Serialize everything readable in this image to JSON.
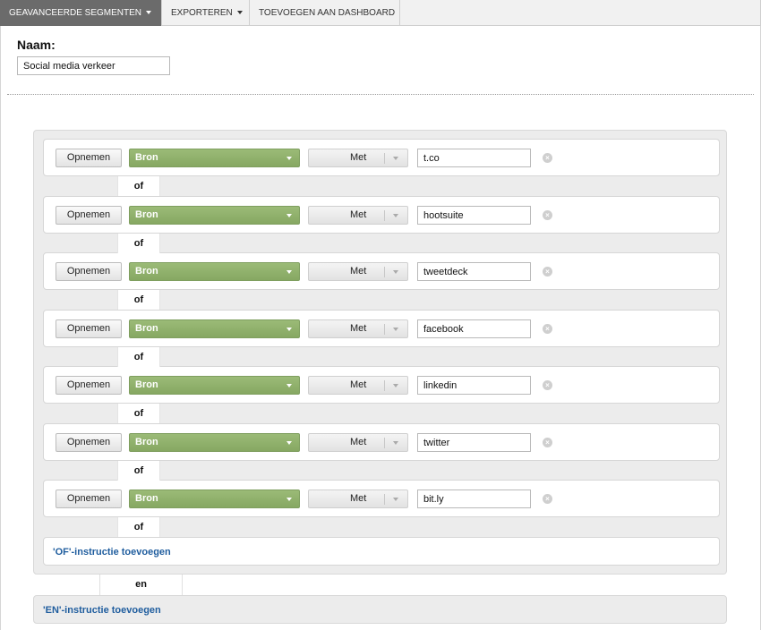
{
  "toolbar": {
    "tabs": [
      {
        "label": "GEAVANCEERDE SEGMENTEN",
        "has_dropdown": true,
        "active": true
      },
      {
        "label": "EXPORTEREN",
        "has_dropdown": true,
        "active": false
      },
      {
        "label": "TOEVOEGEN AAN DASHBOARD",
        "has_dropdown": false,
        "active": false
      }
    ]
  },
  "segment": {
    "name_label": "Naam:",
    "name_value": "Social media verkeer"
  },
  "conditions": [
    {
      "include_label": "Opnemen",
      "dimension": "Bron",
      "operator": "Met",
      "value": "t.co"
    },
    {
      "include_label": "Opnemen",
      "dimension": "Bron",
      "operator": "Met",
      "value": "hootsuite"
    },
    {
      "include_label": "Opnemen",
      "dimension": "Bron",
      "operator": "Met",
      "value": "tweetdeck"
    },
    {
      "include_label": "Opnemen",
      "dimension": "Bron",
      "operator": "Met",
      "value": "facebook"
    },
    {
      "include_label": "Opnemen",
      "dimension": "Bron",
      "operator": "Met",
      "value": "linkedin"
    },
    {
      "include_label": "Opnemen",
      "dimension": "Bron",
      "operator": "Met",
      "value": "twitter"
    },
    {
      "include_label": "Opnemen",
      "dimension": "Bron",
      "operator": "Met",
      "value": "bit.ly"
    }
  ],
  "or_label": "of",
  "add_or_link": "'OF'-instructie toevoegen",
  "and_label": "en",
  "add_and_link": "'EN'-instructie toevoegen",
  "icons": {
    "remove": "remove-circle-icon",
    "dropdown": "caret-down-icon"
  },
  "colors": {
    "active_tab": "#6b6b6b",
    "dimension_dropdown": "#8fb26b",
    "link": "#1f5d9e",
    "group_bg": "#ececec"
  }
}
